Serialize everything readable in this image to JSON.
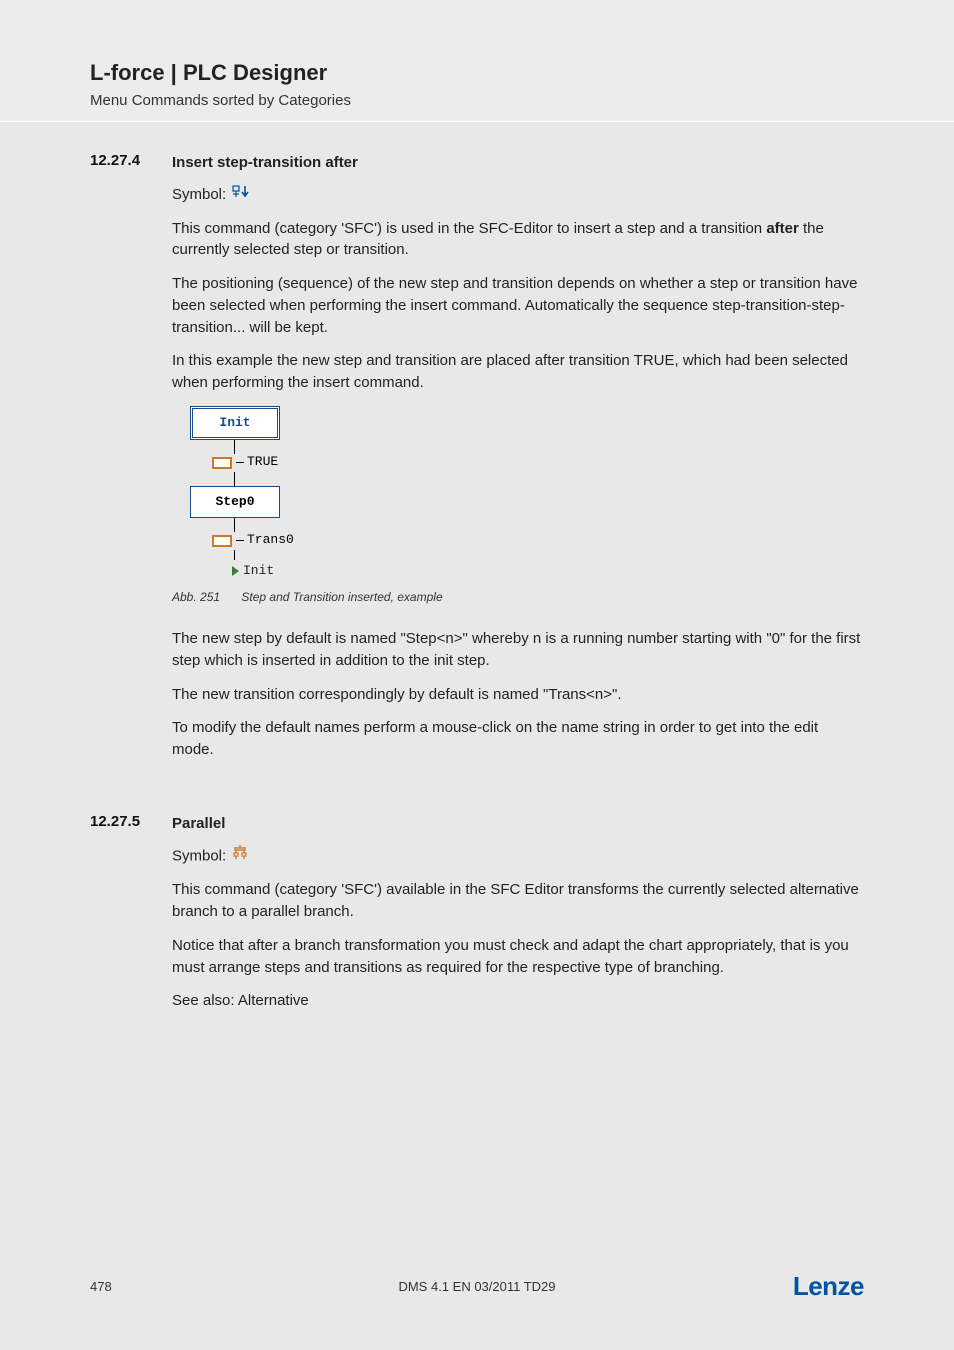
{
  "header": {
    "title": "L-force | PLC Designer",
    "subtitle": "Menu Commands sorted by Categories"
  },
  "sections": [
    {
      "number": "12.27.4",
      "heading": "Insert step-transition after",
      "symbol_label": "Symbol:",
      "paragraphs_before": [
        "This command (category 'SFC') is used in the SFC-Editor to insert a step and a transition after the currently selected step or transition.",
        "The positioning (sequence) of the new step and transition depends on whether a step or transition have been selected when performing the insert command. Automatically the sequence step-transition-step-transition... will be kept.",
        "In this example the new step and transition are placed after transition TRUE, which had been selected when performing the insert command."
      ],
      "diagram": {
        "init": "Init",
        "trans1": "TRUE",
        "step": "Step0",
        "trans2": "Trans0",
        "jump": "Init"
      },
      "caption_label": "Abb. 251",
      "caption_text": "Step and Transition inserted, example",
      "paragraphs_after": [
        "The new step by default is named \"Step<n>\" whereby n is a running number starting with \"0\" for the first step which is inserted in addition to the init step.",
        "The new transition correspondingly by default is named \"Trans<n>\".",
        "To modify the default names perform a mouse-click on the name string in order to get into the edit mode."
      ]
    },
    {
      "number": "12.27.5",
      "heading": "Parallel",
      "symbol_label": "Symbol:",
      "paragraphs": [
        "This command (category 'SFC') available in the SFC Editor transforms the currently selected alternative branch to a parallel branch.",
        "Notice that after a branch transformation you must check and adapt the chart appropriately, that is you must arrange steps and transitions as required for the respective type of branching.",
        "See also: Alternative"
      ]
    }
  ],
  "footer": {
    "page": "478",
    "center": "DMS 4.1 EN 03/2011 TD29",
    "logo": "Lenze"
  }
}
